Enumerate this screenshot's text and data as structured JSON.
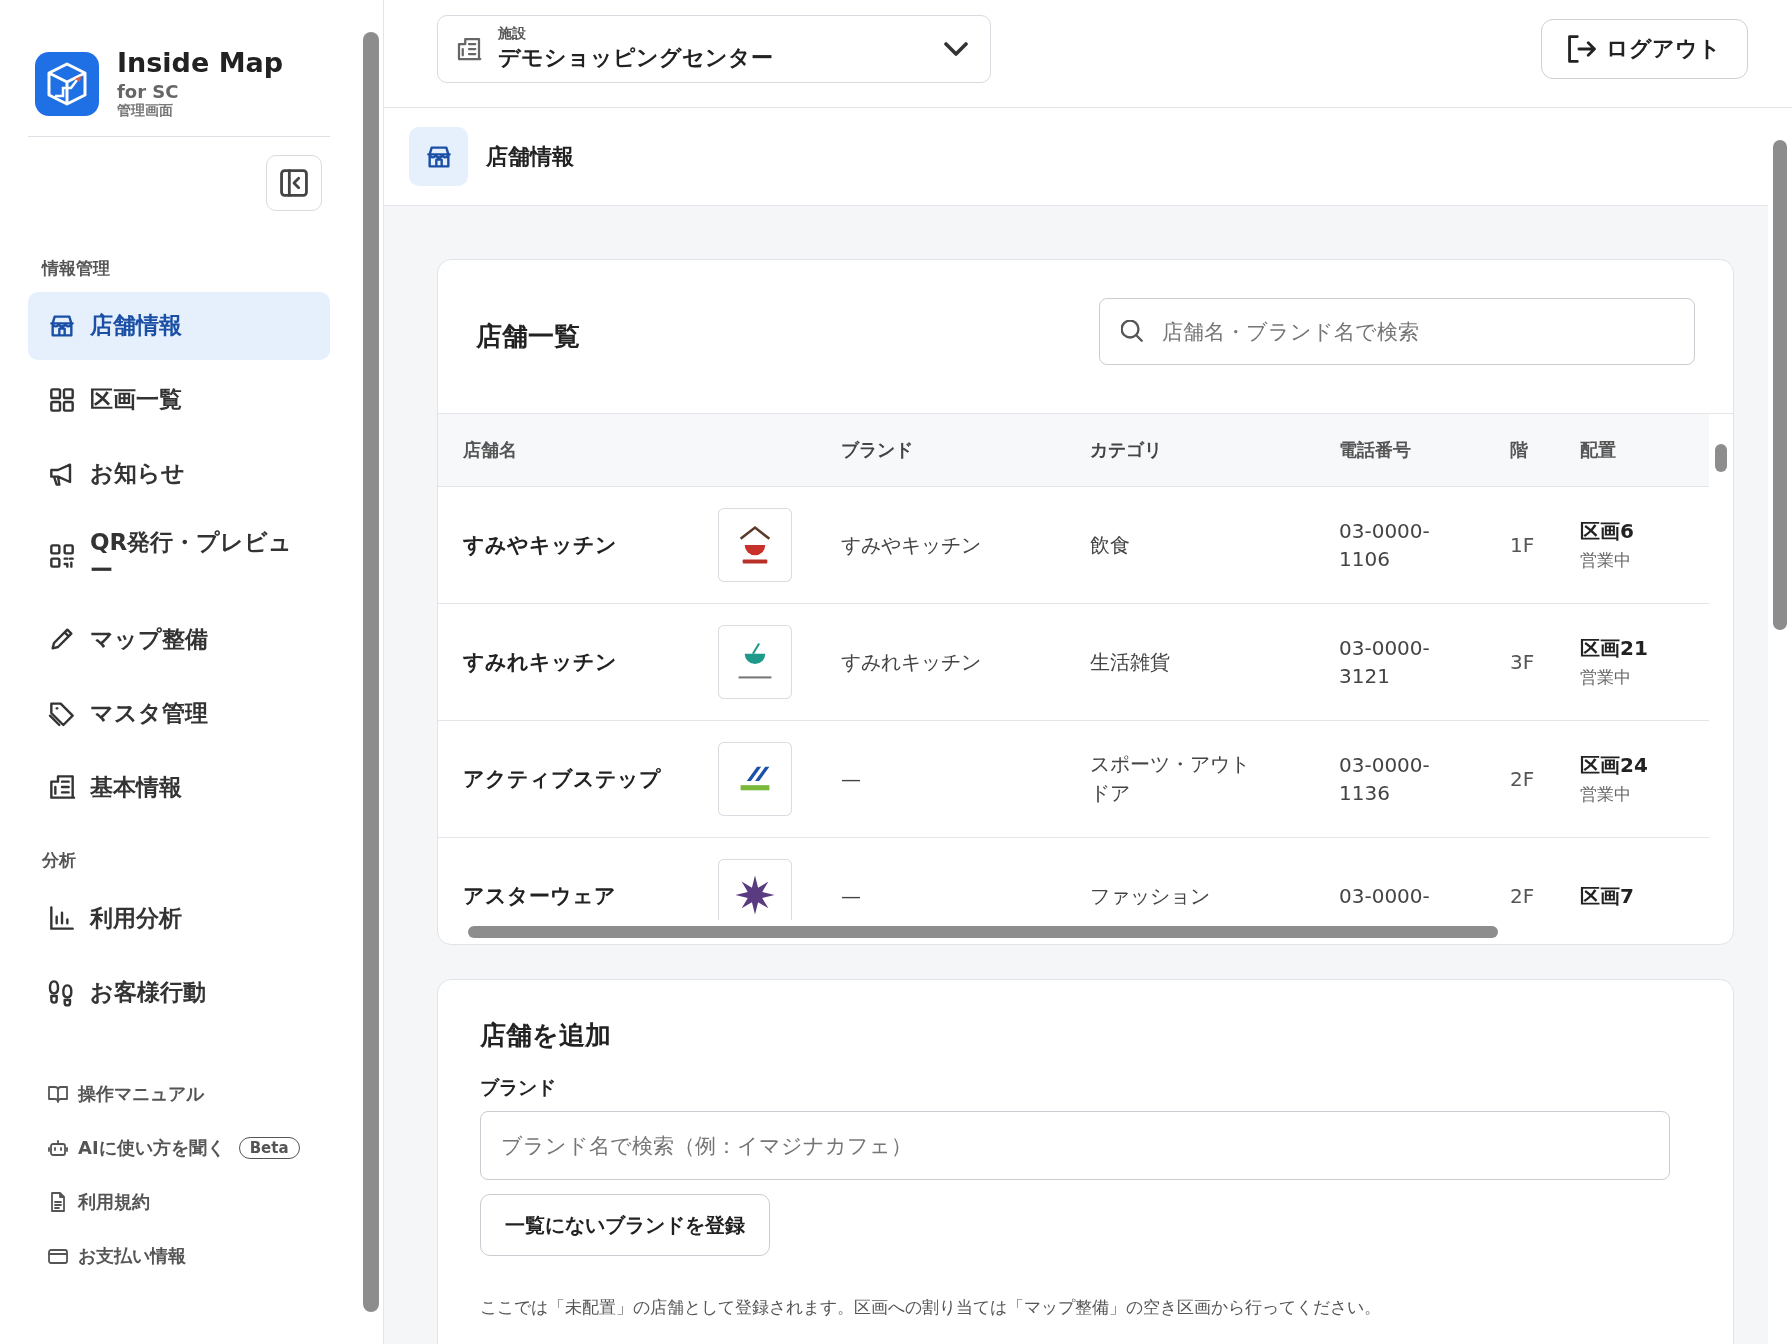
{
  "app": {
    "name": "Inside Map",
    "subtitle": "for SC",
    "caption": "管理画面"
  },
  "sidebar": {
    "sections": [
      {
        "title": "情報管理",
        "items": [
          {
            "label": "店舗情報",
            "selected": true
          },
          {
            "label": "区画一覧",
            "selected": false
          },
          {
            "label": "お知らせ",
            "selected": false
          },
          {
            "label": "QR発行・プレビュー",
            "selected": false
          },
          {
            "label": "マップ整備",
            "selected": false
          },
          {
            "label": "マスタ管理",
            "selected": false
          },
          {
            "label": "基本情報",
            "selected": false
          }
        ]
      },
      {
        "title": "分析",
        "items": [
          {
            "label": "利用分析",
            "selected": false
          },
          {
            "label": "お客様行動",
            "selected": false
          }
        ]
      }
    ],
    "footer_links": [
      {
        "label": "操作マニュアル"
      },
      {
        "label": "AIに使い方を聞く",
        "badge": "Beta"
      },
      {
        "label": "利用規約"
      },
      {
        "label": "お支払い情報"
      }
    ]
  },
  "facility_select": {
    "label": "施設",
    "value": "デモショッピングセンター"
  },
  "logout_button": "ログアウト",
  "page_title": "店舗情報",
  "store_list": {
    "title": "店舗一覧",
    "search": {
      "placeholder": "店舗名・ブランド名で検索"
    },
    "columns": [
      "店舗名",
      "ブランド",
      "カテゴリ",
      "電話番号",
      "階",
      "配置"
    ],
    "rows": [
      {
        "name": "すみやキッチン",
        "brand": "すみやキッチン",
        "category": "飲食",
        "phone": "03-0000-1106",
        "floor": "1F",
        "location": "区画6",
        "status": "営業中"
      },
      {
        "name": "すみれキッチン",
        "brand": "すみれキッチン",
        "category": "生活雑貨",
        "phone": "03-0000-3121",
        "floor": "3F",
        "location": "区画21",
        "status": "営業中"
      },
      {
        "name": "アクティブステップ",
        "brand": "—",
        "category": "スポーツ・アウトドア",
        "phone": "03-0000-1136",
        "floor": "2F",
        "location": "区画24",
        "status": "営業中"
      },
      {
        "name": "アスターウェア",
        "brand": "—",
        "category": "ファッション",
        "phone": "03-0000-",
        "floor": "2F",
        "location": "区画7"
      }
    ]
  },
  "add_store": {
    "title": "店舗を追加",
    "brand_label": "ブランド",
    "brand_placeholder": "ブランド名で検索（例：イマジナカフェ）",
    "register_button": "一覧にないブランドを登録",
    "note": "ここでは「未配置」の店舗として登録されます。区画への割り当ては「マップ整備」の空き区画から行ってください。"
  }
}
